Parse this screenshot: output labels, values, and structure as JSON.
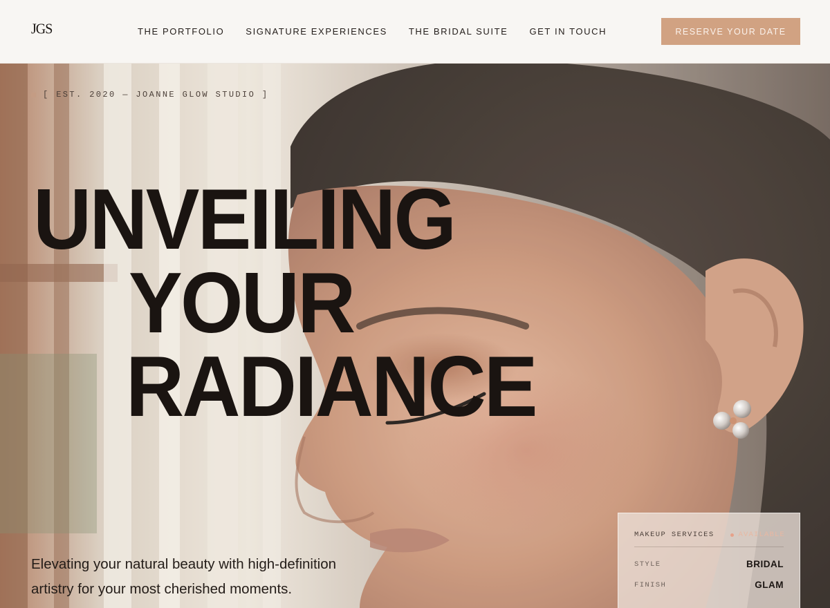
{
  "header": {
    "logo": "JGS",
    "nav": [
      "THE PORTFOLIO",
      "SIGNATURE EXPERIENCES",
      "THE BRIDAL SUITE",
      "GET IN TOUCH"
    ],
    "cta_label": "RESERVE YOUR DATE"
  },
  "hero": {
    "eyebrow": "[ EST. 2020 — JOANNE GLOW STUDIO ]",
    "headline": [
      "UNVEILING",
      "YOUR",
      "RADIANCE"
    ],
    "subtext_line1": "Elevating your natural beauty with high-definition",
    "subtext_line2": "artistry for your most cherished moments.",
    "photo": "bride-profile-photo"
  },
  "services_card": {
    "title": "MAKEUP SERVICES",
    "status": "AVAILABLE",
    "rows": [
      {
        "key": "STYLE",
        "value": "BRIDAL"
      },
      {
        "key": "FINISH",
        "value": "GLAM"
      }
    ]
  },
  "colors": {
    "accent": "#d1a282",
    "background": "#f8f6f3",
    "text": "#1a1411"
  }
}
